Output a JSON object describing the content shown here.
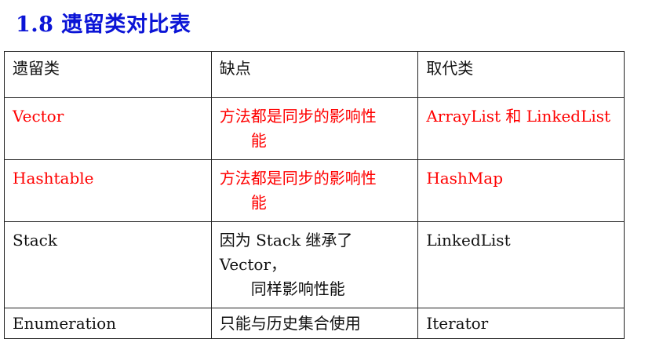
{
  "heading": "1.8 遗留类对比表",
  "colors": {
    "heading": "#0b14d6",
    "highlight": "#ff0000",
    "text": "#111111"
  },
  "table": {
    "headers": [
      "遗留类",
      "缺点",
      "取代类"
    ],
    "rows": [
      {
        "legacy": "Vector",
        "drawback_line1": "方法都是同步的影响性",
        "drawback_line2": "能",
        "replacement": "ArrayList 和 LinkedList",
        "highlight": true
      },
      {
        "legacy": "Hashtable",
        "drawback_line1": "方法都是同步的影响性",
        "drawback_line2": "能",
        "replacement": "HashMap",
        "highlight": true
      },
      {
        "legacy": "Stack",
        "drawback_line1": "因为 Stack 继承了 Vector，",
        "drawback_line2": "同样影响性能",
        "replacement": "LinkedList",
        "highlight": false
      },
      {
        "legacy": "Enumeration",
        "drawback_line1": "只能与历史集合使用",
        "drawback_line2": "",
        "replacement": "Iterator",
        "highlight": false
      }
    ]
  }
}
